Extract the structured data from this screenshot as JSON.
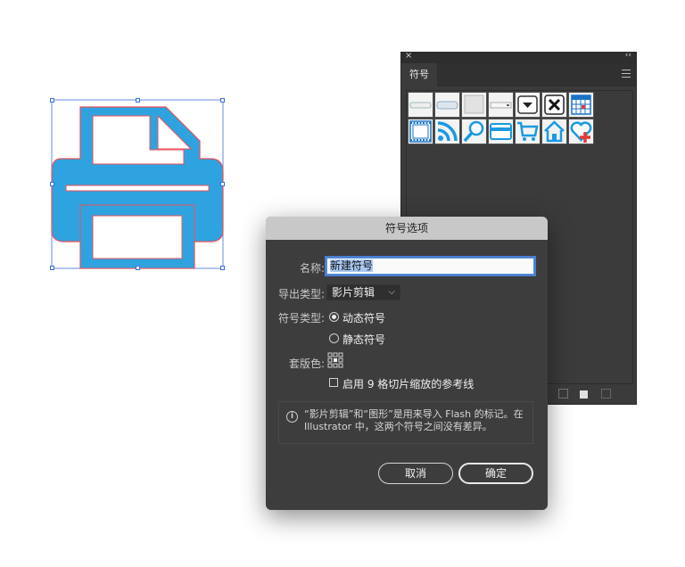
{
  "symbols_panel": {
    "tab_label": "符号",
    "close_glyph": "×",
    "collapse_glyph": "‹‹",
    "symbol_icons": [
      "button-bar-icon",
      "button-rounded-icon",
      "button-plain-icon",
      "button-flat-icon",
      "dropdown-icon",
      "close-box-icon",
      "calendar-icon",
      "film-strip-icon",
      "rss-icon",
      "magnifier-icon",
      "credit-card-icon",
      "cart-icon",
      "home-icon",
      "heart-plus-icon"
    ]
  },
  "dialog": {
    "title": "符号选项",
    "name_label": "名称:",
    "name_value": "新建符号",
    "export_type_label": "导出类型:",
    "export_type_value": "影片剪辑",
    "symbol_type_label": "符号类型:",
    "symbol_type_dynamic": "动态符号",
    "symbol_type_static": "静态符号",
    "symbol_type_selected": "动态符号",
    "registration_label": "套版色:",
    "nine_slice_label": "启用 9 格切片缩放的参考线",
    "nine_slice_checked": false,
    "info_text": "“影片剪辑”和“图形”是用来导入 Flash 的标记。在 Illustrator 中，这两个符号之间没有差异。",
    "cancel_label": "取消",
    "ok_label": "确定"
  },
  "colors": {
    "printer_fill": "#2fa3e0",
    "printer_stroke": "#e8505b",
    "selection": "#3a6fd8"
  }
}
